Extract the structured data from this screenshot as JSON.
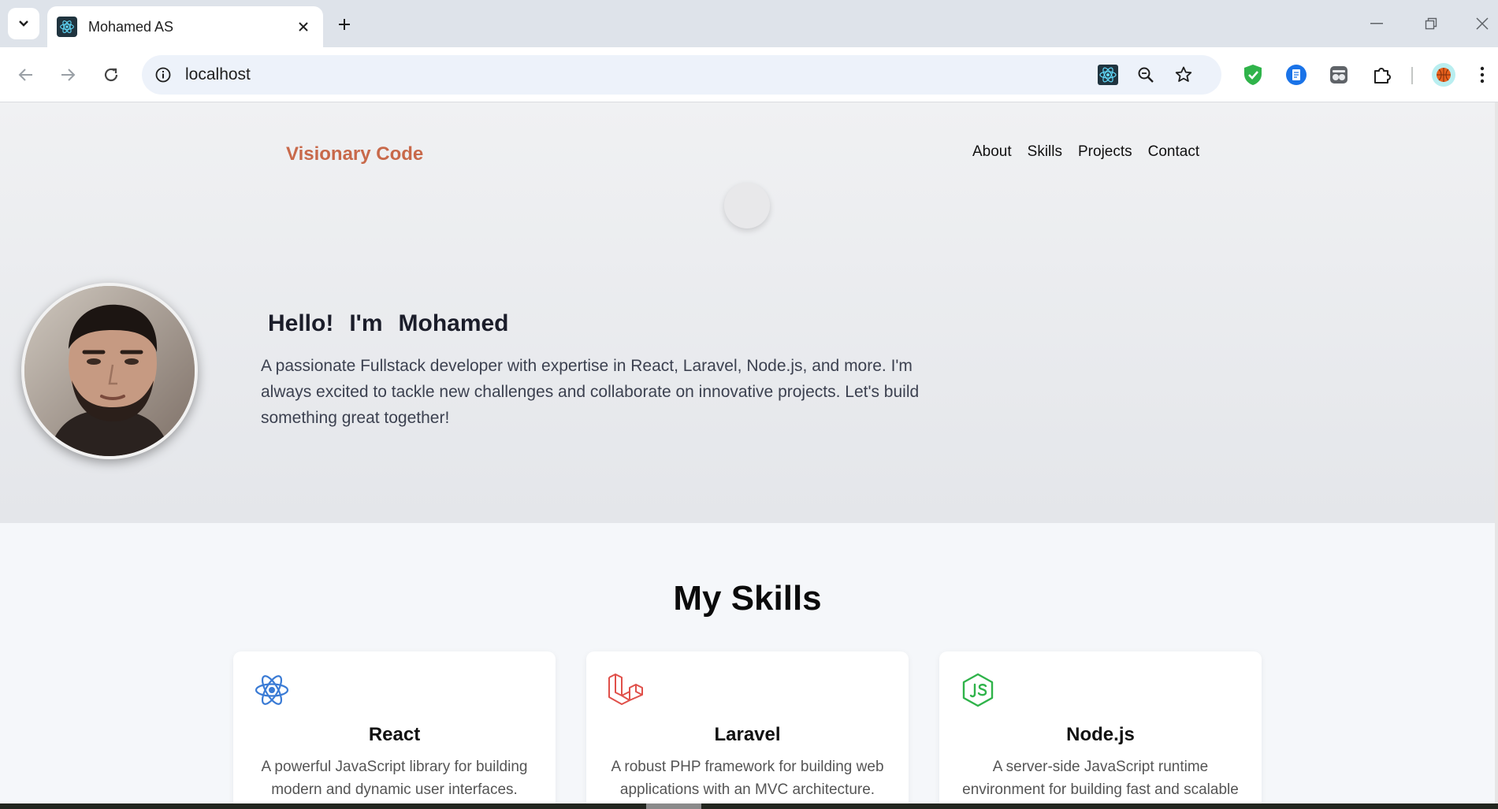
{
  "browser": {
    "tab_title": "Mohamed AS",
    "url": "localhost"
  },
  "site": {
    "brand": "Visionary Code",
    "nav": [
      "About",
      "Skills",
      "Projects",
      "Contact"
    ],
    "hero": {
      "greeting": [
        "Hello!",
        "I'm",
        "Mohamed"
      ],
      "intro": "A passionate Fullstack developer with expertise in React, Laravel, Node.js, and more. I'm always excited to tackle new challenges and collaborate on innovative projects. Let's build something great together!"
    },
    "skills": {
      "title": "My Skills",
      "cards": [
        {
          "title": "React",
          "desc": "A powerful JavaScript library for building modern and dynamic user interfaces.",
          "icon": "react-icon",
          "color": "#3a7bd5"
        },
        {
          "title": "Laravel",
          "desc": "A robust PHP framework for building web applications with an MVC architecture.",
          "icon": "laravel-icon",
          "color": "#e0504a"
        },
        {
          "title": "Node.js",
          "desc": "A server-side JavaScript runtime environment for building fast and scalable network applications.",
          "icon": "nodejs-icon",
          "color": "#2fb34a"
        }
      ]
    }
  },
  "colors": {
    "brand": "#c8694a",
    "react": "#3a7bd5",
    "laravel": "#e0504a",
    "node": "#2fb34a"
  }
}
